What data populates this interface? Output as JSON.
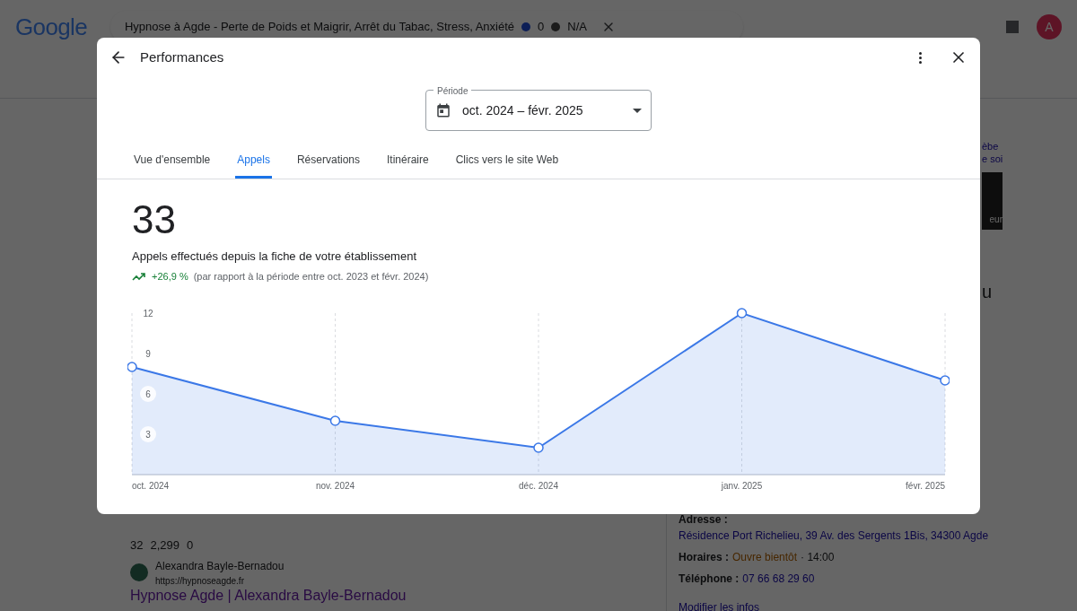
{
  "background": {
    "logo": "Google",
    "search_query": "Hypnose à Agde - Perte de Poids et Maigrir, Arrêt du Tabac, Stress, Anxiété",
    "flag_count": "0",
    "rating": "N/A",
    "avatar": "A",
    "panel_fragments": [
      "èbe",
      "e soi",
      "eur",
      "u"
    ],
    "result": {
      "stats": [
        "32",
        "2,299",
        "0"
      ],
      "site_name": "Alexandra Bayle-Bernadou",
      "url": "https://hypnoseagde.fr",
      "title": "Hypnose Agde | Alexandra Bayle-Bernadou"
    },
    "info": [
      {
        "label": "Adresse :",
        "value": "Résidence Port Richelieu, 39 Av. des Sergents 1Bis, 34300 Agde",
        "kind": "link"
      },
      {
        "label": "Horaires :",
        "value": "Ouvre bientôt",
        "extra": "· 14:00",
        "kind": "hours"
      },
      {
        "label": "Téléphone :",
        "value": "07 66 68 29 60",
        "kind": "link"
      }
    ],
    "edit_link": "Modifier les infos"
  },
  "modal": {
    "title": "Performances",
    "period": {
      "label": "Période",
      "value": "oct. 2024 – févr. 2025"
    },
    "tabs": [
      {
        "label": "Vue d'ensemble",
        "selected": false
      },
      {
        "label": "Appels",
        "selected": true
      },
      {
        "label": "Réservations",
        "selected": false
      },
      {
        "label": "Itinéraire",
        "selected": false
      },
      {
        "label": "Clics vers le site Web",
        "selected": false
      }
    ],
    "metric": {
      "value": "33",
      "description": "Appels effectués depuis la fiche de votre établissement",
      "change": "+26,9 %",
      "comparison": "(par rapport à la période entre oct. 2023 et févr. 2024)"
    },
    "chart_data": {
      "type": "area",
      "categories": [
        "oct. 2024",
        "nov. 2024",
        "déc. 2024",
        "janv. 2025",
        "févr. 2025"
      ],
      "series": [
        {
          "color": "#3b78e7",
          "values": [
            8,
            4,
            2,
            12,
            7
          ]
        }
      ],
      "ylim": [
        0,
        12
      ],
      "yticks": [
        3,
        6,
        9,
        12
      ],
      "grid": true
    }
  }
}
